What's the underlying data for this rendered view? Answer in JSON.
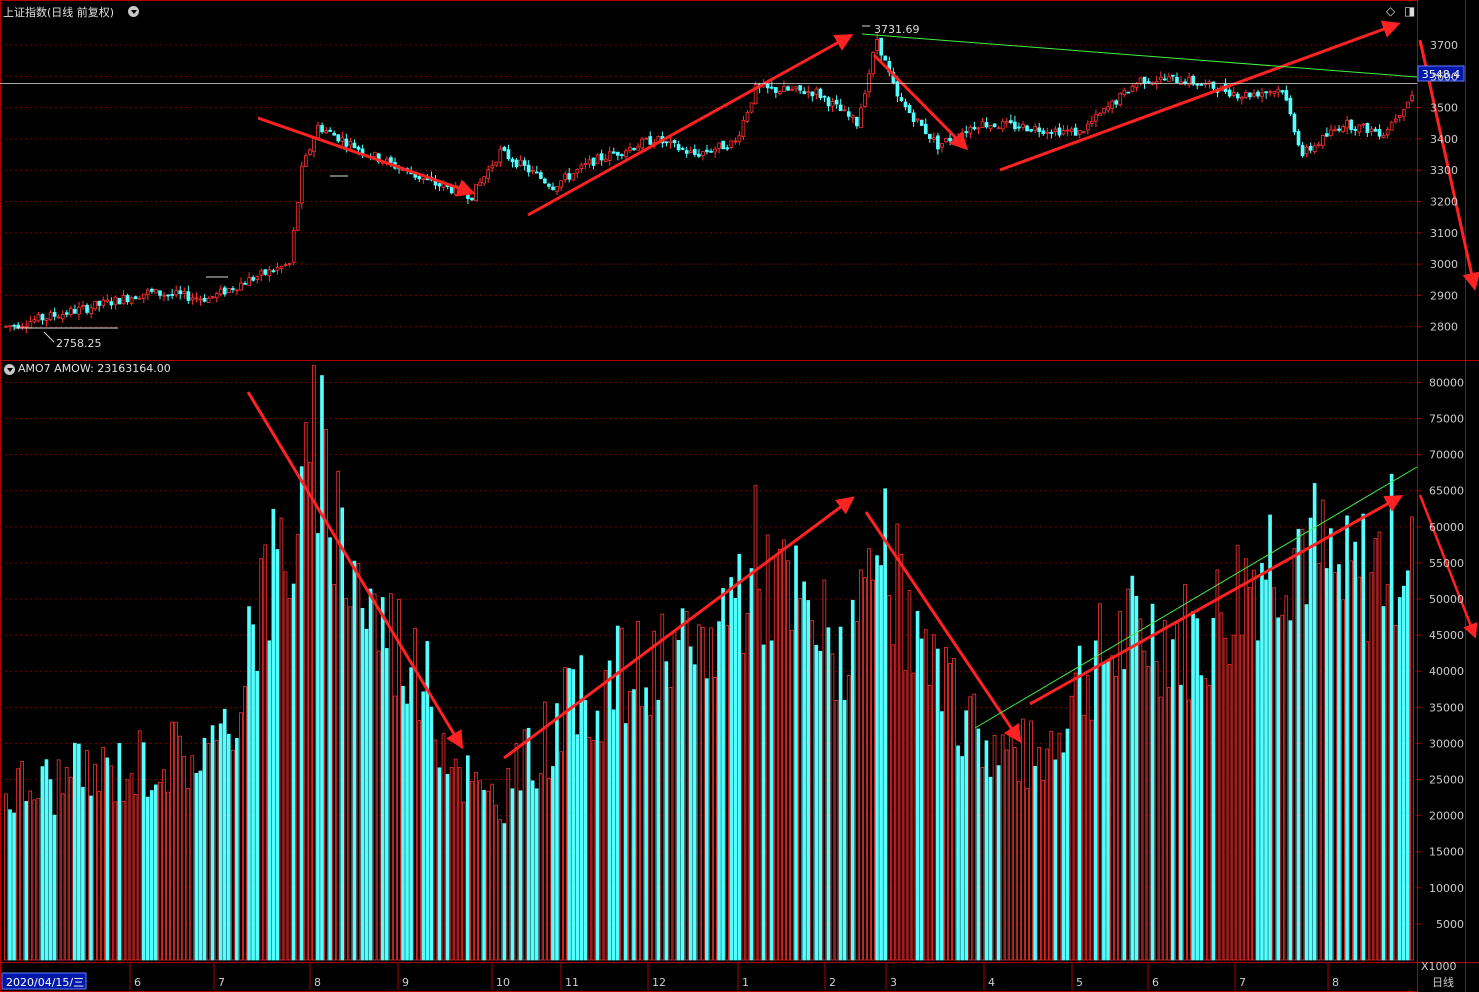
{
  "app": {
    "price_title": "上证指数(日线 前复权)",
    "volume_title": "AMO7  AMOW: 23163164.00",
    "period": "日线",
    "unit": "X1000",
    "date_label": "2020/04/15/三"
  },
  "colors": {
    "up": "#ff3232",
    "down": "#54ffff",
    "frame": "#b00000",
    "arrow": "#ff2222",
    "trend": "#44ee44"
  },
  "price_axis": {
    "ticks": [
      "2800",
      "2900",
      "3000",
      "3100",
      "3200",
      "3300",
      "3400",
      "3500",
      "3600",
      "3700"
    ],
    "highlight": "3548.4",
    "high_label": "3731.69",
    "low_label": "2758.25"
  },
  "volume_axis": {
    "ticks": [
      "5000",
      "10000",
      "15000",
      "20000",
      "25000",
      "30000",
      "35000",
      "40000",
      "45000",
      "50000",
      "55000",
      "60000",
      "65000",
      "70000",
      "75000",
      "80000"
    ]
  },
  "months": [
    "6",
    "7",
    "8",
    "9",
    "10",
    "11",
    "12",
    "1",
    "2",
    "3",
    "4",
    "5",
    "6",
    "7",
    "8"
  ],
  "chart_data": [
    {
      "type": "candlestick",
      "title": "上证指数(日线 前复权)",
      "x": "trading days 2020-04-15 … 2021-08",
      "ylim": [
        2700,
        3780
      ],
      "key_levels": {
        "high": 3731.69,
        "low": 2758.25,
        "last": 3548.4
      },
      "path_anchor_points": [
        [
          0,
          2800
        ],
        [
          20,
          2860
        ],
        [
          35,
          2910
        ],
        [
          50,
          2890
        ],
        [
          60,
          2950
        ],
        [
          70,
          3000
        ],
        [
          73,
          3300
        ],
        [
          77,
          3440
        ],
        [
          90,
          3350
        ],
        [
          105,
          3260
        ],
        [
          115,
          3220
        ],
        [
          122,
          3360
        ],
        [
          135,
          3250
        ],
        [
          145,
          3330
        ],
        [
          160,
          3400
        ],
        [
          170,
          3350
        ],
        [
          180,
          3390
        ],
        [
          185,
          3560
        ],
        [
          200,
          3550
        ],
        [
          210,
          3450
        ],
        [
          215,
          3720
        ],
        [
          220,
          3530
        ],
        [
          230,
          3380
        ],
        [
          240,
          3450
        ],
        [
          250,
          3440
        ],
        [
          265,
          3420
        ],
        [
          280,
          3590
        ],
        [
          290,
          3590
        ],
        [
          300,
          3560
        ],
        [
          305,
          3540
        ],
        [
          315,
          3560
        ],
        [
          320,
          3350
        ],
        [
          330,
          3450
        ],
        [
          340,
          3420
        ],
        [
          347,
          3540
        ]
      ]
    },
    {
      "type": "bar",
      "title": "AMO7  AMOW: 23163164.00",
      "unit": "X1000",
      "ylim": [
        0,
        82000
      ],
      "path_anchor_points": [
        [
          0,
          24000
        ],
        [
          20,
          26000
        ],
        [
          40,
          29000
        ],
        [
          55,
          30000
        ],
        [
          60,
          48000
        ],
        [
          70,
          60000
        ],
        [
          73,
          62000
        ],
        [
          76,
          72000
        ],
        [
          90,
          50000
        ],
        [
          100,
          43000
        ],
        [
          110,
          30000
        ],
        [
          118,
          22000
        ],
        [
          125,
          25000
        ],
        [
          135,
          33000
        ],
        [
          150,
          40000
        ],
        [
          170,
          42000
        ],
        [
          185,
          57000
        ],
        [
          200,
          47000
        ],
        [
          210,
          43000
        ],
        [
          215,
          58000
        ],
        [
          230,
          38000
        ],
        [
          245,
          30000
        ],
        [
          255,
          28000
        ],
        [
          265,
          40000
        ],
        [
          280,
          47000
        ],
        [
          295,
          45000
        ],
        [
          310,
          57000
        ],
        [
          320,
          60000
        ],
        [
          330,
          52000
        ],
        [
          347,
          60000
        ]
      ]
    }
  ]
}
